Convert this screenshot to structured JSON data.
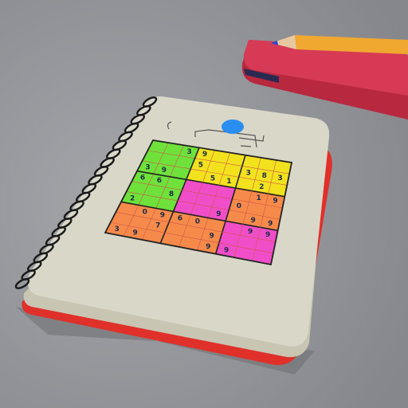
{
  "scene": {
    "colors": {
      "background": "#8e9094",
      "page": "#d9d7c8",
      "edge": "#e0302a",
      "spiral": "#1a1a1a",
      "case": "#d63a55",
      "pencil": "#f0a830",
      "green": "#6ee23a",
      "yellow": "#f2e21e",
      "pink": "#f04ec8",
      "orange": "#f68a4a"
    },
    "block_colors": [
      [
        "green",
        "yellow",
        "yellow"
      ],
      [
        "green",
        "pink",
        "orange"
      ],
      [
        "orange",
        "orange",
        "pink"
      ]
    ],
    "sudoku_digits": [
      {
        "r": 0,
        "c": 2,
        "t": "3"
      },
      {
        "r": 0,
        "c": 3,
        "t": "9"
      },
      {
        "r": 1,
        "c": 3,
        "t": "5"
      },
      {
        "r": 1,
        "c": 7,
        "t": "8"
      },
      {
        "r": 1,
        "c": 8,
        "t": "3"
      },
      {
        "r": 1,
        "c": 6,
        "t": "3"
      },
      {
        "r": 2,
        "c": 0,
        "t": "3"
      },
      {
        "r": 2,
        "c": 1,
        "t": "9"
      },
      {
        "r": 2,
        "c": 4,
        "t": "5"
      },
      {
        "r": 2,
        "c": 5,
        "t": "1"
      },
      {
        "r": 2,
        "c": 7,
        "t": "2"
      },
      {
        "r": 3,
        "c": 0,
        "t": "6"
      },
      {
        "r": 3,
        "c": 1,
        "t": "6"
      },
      {
        "r": 3,
        "c": 7,
        "t": "1"
      },
      {
        "r": 3,
        "c": 8,
        "t": "9"
      },
      {
        "r": 4,
        "c": 2,
        "t": "8"
      },
      {
        "r": 4,
        "c": 6,
        "t": "0"
      },
      {
        "r": 5,
        "c": 0,
        "t": "2"
      },
      {
        "r": 5,
        "c": 5,
        "t": "9"
      },
      {
        "r": 5,
        "c": 7,
        "t": "9"
      },
      {
        "r": 5,
        "c": 8,
        "t": "9"
      },
      {
        "r": 6,
        "c": 1,
        "t": "0"
      },
      {
        "r": 6,
        "c": 2,
        "t": "9"
      },
      {
        "r": 6,
        "c": 3,
        "t": "6"
      },
      {
        "r": 6,
        "c": 4,
        "t": "0"
      },
      {
        "r": 6,
        "c": 7,
        "t": "9"
      },
      {
        "r": 6,
        "c": 8,
        "t": "9"
      },
      {
        "r": 7,
        "c": 2,
        "t": "7"
      },
      {
        "r": 7,
        "c": 5,
        "t": "9"
      },
      {
        "r": 8,
        "c": 0,
        "t": "3"
      },
      {
        "r": 8,
        "c": 1,
        "t": "9"
      },
      {
        "r": 8,
        "c": 5,
        "t": "9"
      },
      {
        "r": 8,
        "c": 6,
        "t": "9"
      }
    ]
  }
}
